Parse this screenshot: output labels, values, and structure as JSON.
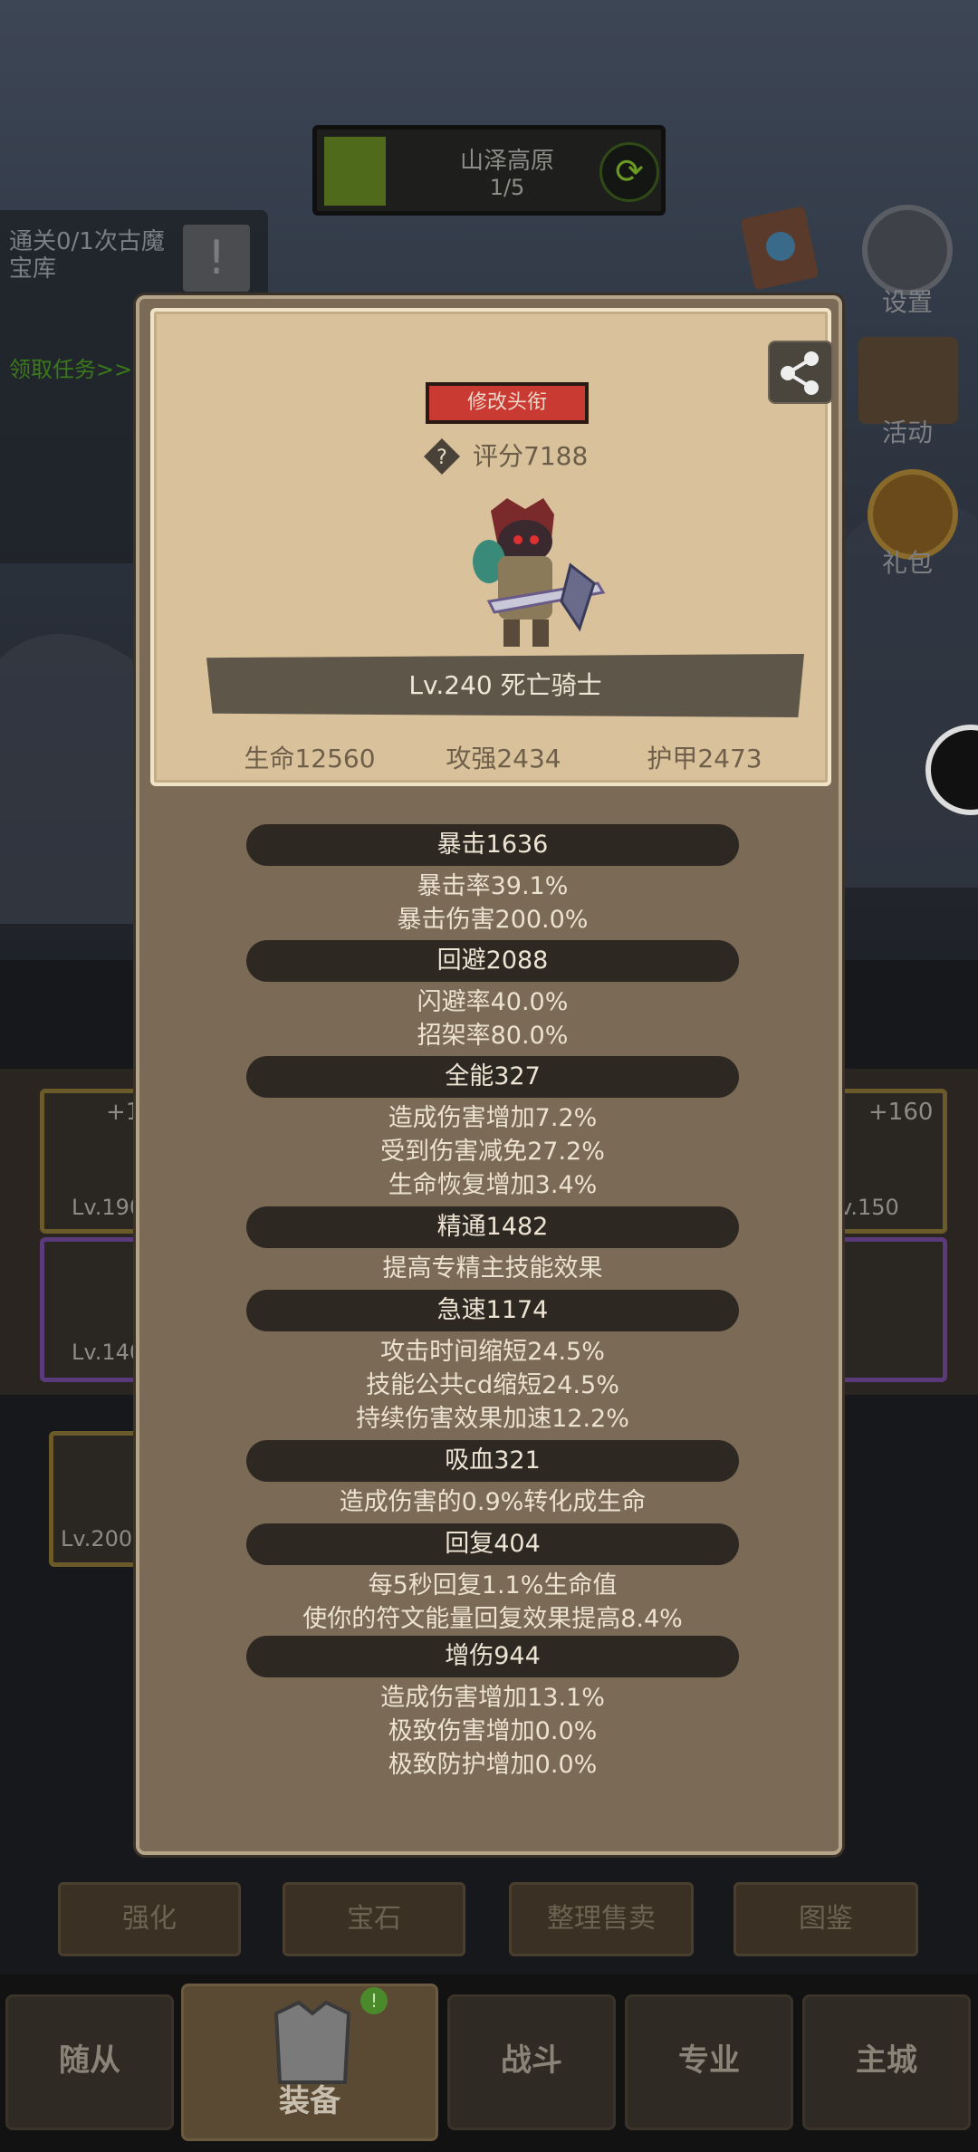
{
  "stage": {
    "name": "山泽高原",
    "progress": "1/5"
  },
  "quest": {
    "text": "通关0/1次古魔宝库",
    "link": "领取任务>>"
  },
  "right_menu": [
    {
      "label": "设置",
      "icon": "gear-icon"
    },
    {
      "label": "活动",
      "icon": "scroll-icon"
    },
    {
      "label": "礼包",
      "icon": "giftbag-icon"
    }
  ],
  "equip_slots": {
    "left_top": {
      "plus": "+1",
      "level": "Lv.190"
    },
    "left_mid": {
      "level": "Lv.140"
    },
    "left_bottom": {
      "level": "Lv.200"
    },
    "right_top": {
      "plus": "+160",
      "level": "v.150"
    }
  },
  "popup": {
    "title_button": "修改头衔",
    "score": "评分7188",
    "hero_name": "Lv.240 死亡骑士",
    "base_stats": [
      "生命12560",
      "攻强2434",
      "护甲2473"
    ],
    "stat_groups": [
      {
        "header": "暴击1636",
        "lines": [
          "暴击率39.1%",
          "暴击伤害200.0%"
        ]
      },
      {
        "header": "回避2088",
        "lines": [
          "闪避率40.0%",
          "招架率80.0%"
        ]
      },
      {
        "header": "全能327",
        "lines": [
          "造成伤害增加7.2%",
          "受到伤害减免27.2%",
          "生命恢复增加3.4%"
        ]
      },
      {
        "header": "精通1482",
        "lines": [
          "提高专精主技能效果"
        ]
      },
      {
        "header": "急速1174",
        "lines": [
          "攻击时间缩短24.5%",
          "技能公共cd缩短24.5%",
          "持续伤害效果加速12.2%"
        ]
      },
      {
        "header": "吸血321",
        "lines": [
          "造成伤害的0.9%转化成生命"
        ]
      },
      {
        "header": "回复404",
        "lines": [
          "每5秒回复1.1%生命值",
          "使你的符文能量回复效果提高8.4%"
        ]
      },
      {
        "header": "增伤944",
        "lines": [
          "造成伤害增加13.1%",
          "极致伤害增加0.0%",
          "极致防护增加0.0%"
        ]
      }
    ]
  },
  "actions": [
    "强化",
    "宝石",
    "整理售卖",
    "图鉴"
  ],
  "nav": [
    "随从",
    "装备",
    "战斗",
    "专业",
    "主城"
  ],
  "nav_badge": "!",
  "colors": {
    "popup_bg": "#7a6a56",
    "card_bg": "#d9c29b",
    "title_red": "#c93a32",
    "header_dark": "#2d2822"
  }
}
